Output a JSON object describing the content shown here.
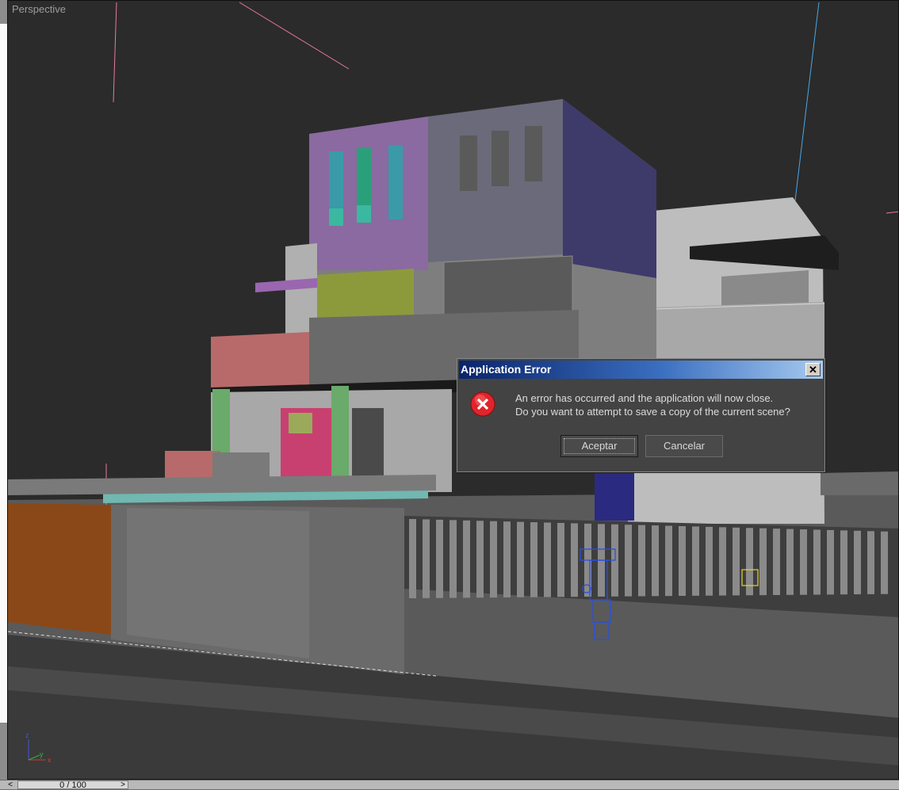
{
  "viewport": {
    "label": "Perspective"
  },
  "gizmo": {
    "z": "z",
    "x": "x",
    "y": "y"
  },
  "timebar": {
    "frame": "0 / 100",
    "prev": "<",
    "next": ">"
  },
  "dialog": {
    "title": "Application Error",
    "close": "✕",
    "icon": "error-icon",
    "line1": "An error has occurred and the application will now close.",
    "line2": "Do you want to attempt to save a copy of the current scene?",
    "ok_label": "Aceptar",
    "cancel_label": "Cancelar"
  },
  "colors": {
    "title_start": "#0a246a",
    "title_end": "#a6caf0",
    "error_red": "#e0242b",
    "viewport_bg": "#2b2b2b"
  }
}
